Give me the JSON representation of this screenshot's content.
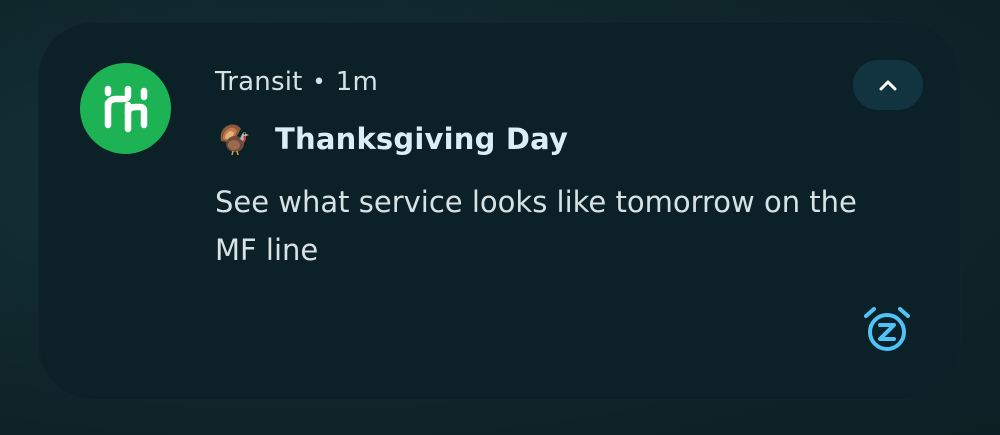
{
  "notification": {
    "app_name": "Transit",
    "separator": "•",
    "time": "1m",
    "title": "Thanksgiving Day",
    "body": "See what service looks like tomorrow on the MF line",
    "icons": {
      "app": "transit-logo-icon",
      "title_emoji": "turkey-icon",
      "collapse": "chevron-up-icon",
      "snooze": "snooze-alarm-icon"
    },
    "colors": {
      "app_icon_bg": "#1db354",
      "card_bg": "#0b2127",
      "title_text": "#d9eef5",
      "accent": "#4fc3f7"
    }
  }
}
